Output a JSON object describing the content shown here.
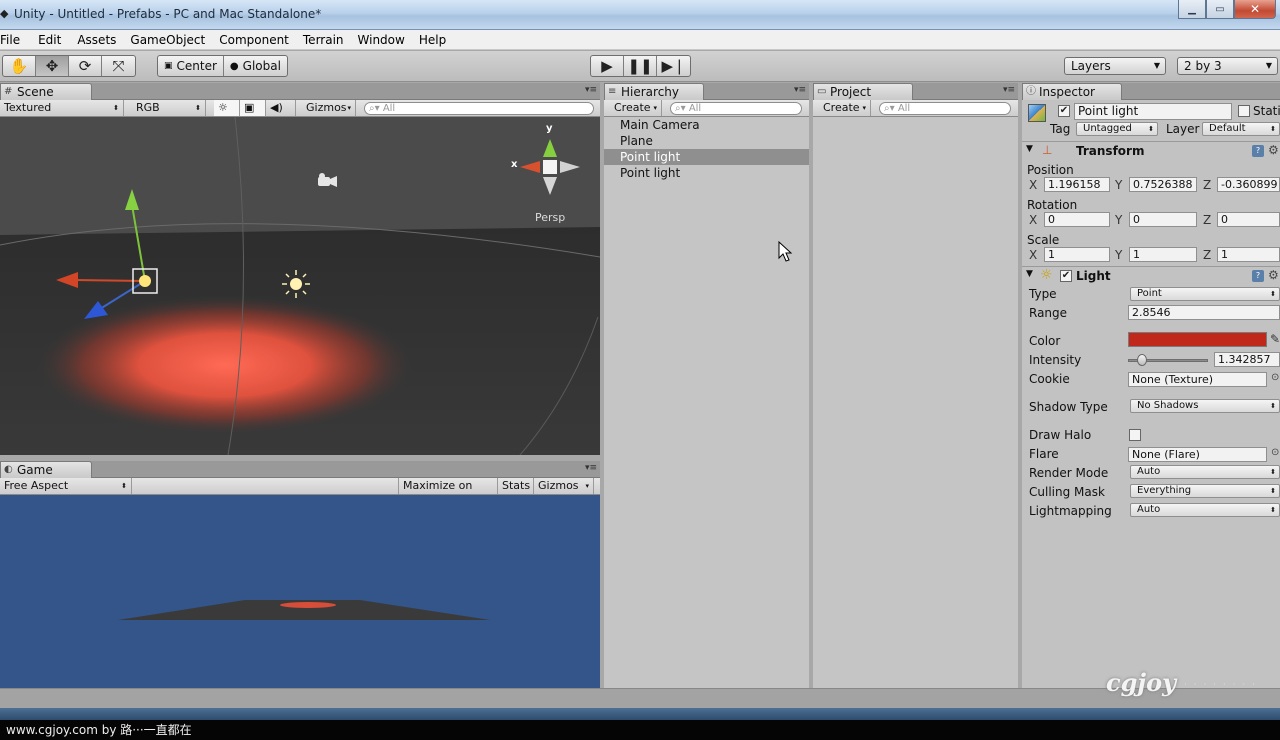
{
  "window": {
    "title": "Unity - Untitled - Prefabs - PC and Mac Standalone*"
  },
  "menu": [
    "File",
    "Edit",
    "Assets",
    "GameObject",
    "Component",
    "Terrain",
    "Window",
    "Help"
  ],
  "toolbar": {
    "pivot": "Center",
    "space": "Global",
    "layers": "Layers",
    "layout": "2 by 3"
  },
  "scene": {
    "tab": "Scene",
    "render_mode": "Textured",
    "color_mode": "RGB",
    "gizmos": "Gizmos",
    "search": "All",
    "persp": "Persp",
    "axes": {
      "y": "y",
      "x": "x"
    }
  },
  "game": {
    "tab": "Game",
    "aspect": "Free Aspect",
    "maximize": "Maximize on Play",
    "stats": "Stats",
    "gizmos": "Gizmos"
  },
  "hierarchy": {
    "tab": "Hierarchy",
    "create": "Create",
    "search": "All",
    "items": [
      "Main Camera",
      "Plane",
      "Point light",
      "Point light"
    ],
    "selected_index": 2
  },
  "project": {
    "tab": "Project",
    "create": "Create",
    "search": "All"
  },
  "inspector": {
    "tab": "Inspector",
    "object_name": "Point light",
    "static_label": "Stati",
    "tag_label": "Tag",
    "tag_value": "Untagged",
    "layer_label": "Layer",
    "layer_value": "Default",
    "transform": {
      "title": "Transform",
      "position_label": "Position",
      "position": {
        "x": "1.196158",
        "y": "0.7526388",
        "z": "-0.360899"
      },
      "rotation_label": "Rotation",
      "rotation": {
        "x": "0",
        "y": "0",
        "z": "0"
      },
      "scale_label": "Scale",
      "scale": {
        "x": "1",
        "y": "1",
        "z": "1"
      },
      "axis_x": "X",
      "axis_y": "Y",
      "axis_z": "Z"
    },
    "light": {
      "title": "Light",
      "type_label": "Type",
      "type_value": "Point",
      "range_label": "Range",
      "range_value": "2.8546",
      "color_label": "Color",
      "color_value": "#c0281c",
      "intensity_label": "Intensity",
      "intensity_value": "1.342857",
      "intensity_fraction": 0.17,
      "cookie_label": "Cookie",
      "cookie_value": "None (Texture)",
      "shadow_label": "Shadow Type",
      "shadow_value": "No Shadows",
      "halo_label": "Draw Halo",
      "flare_label": "Flare",
      "flare_value": "None (Flare)",
      "render_label": "Render Mode",
      "render_value": "Auto",
      "culling_label": "Culling Mask",
      "culling_value": "Everything",
      "lightmap_label": "Lightmapping",
      "lightmap_value": "Auto"
    }
  },
  "footer": {
    "watermark": "www.cgjoy.com by 路···一直都在",
    "logo": "cgjoy"
  }
}
